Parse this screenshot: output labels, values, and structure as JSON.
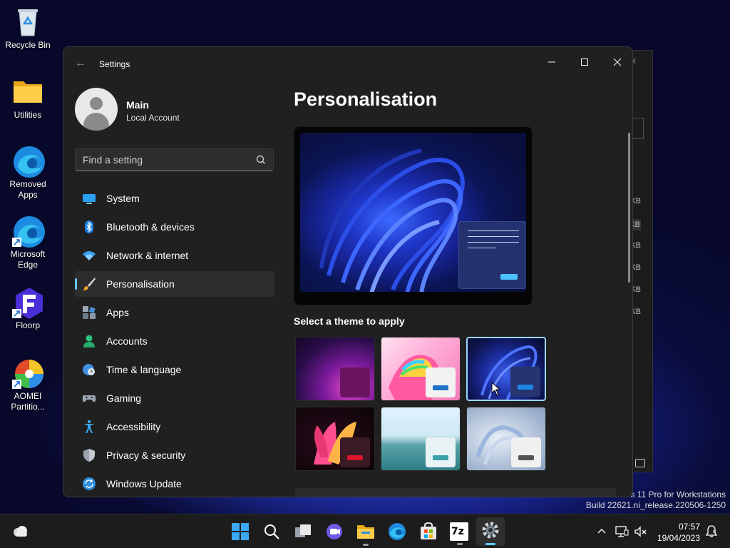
{
  "desktop": {
    "icons": [
      {
        "label": "Recycle Bin"
      },
      {
        "label": "Utilities"
      },
      {
        "label": "Removed Apps"
      },
      {
        "label": "Microsoft Edge"
      },
      {
        "label": "Floorp"
      },
      {
        "label": "AOMEI Partitio..."
      }
    ],
    "watermark": {
      "line1": "s 11 Pro for Workstations",
      "line2": "Build 22621.ni_release.220506-1250"
    },
    "back_window": {
      "size_suffix": "KB"
    }
  },
  "settings": {
    "title": "Settings",
    "user": {
      "name": "Main",
      "account_type": "Local Account"
    },
    "search": {
      "placeholder": "Find a setting",
      "value": ""
    },
    "nav": [
      {
        "label": "System",
        "icon": "monitor-icon"
      },
      {
        "label": "Bluetooth & devices",
        "icon": "bluetooth-icon"
      },
      {
        "label": "Network & internet",
        "icon": "wifi-icon"
      },
      {
        "label": "Personalisation",
        "icon": "paintbrush-icon",
        "active": true
      },
      {
        "label": "Apps",
        "icon": "apps-icon"
      },
      {
        "label": "Accounts",
        "icon": "person-icon"
      },
      {
        "label": "Time & language",
        "icon": "clock-globe-icon"
      },
      {
        "label": "Gaming",
        "icon": "gamepad-icon"
      },
      {
        "label": "Accessibility",
        "icon": "accessibility-icon"
      },
      {
        "label": "Privacy & security",
        "icon": "shield-icon"
      },
      {
        "label": "Windows Update",
        "icon": "update-icon"
      }
    ],
    "page": {
      "title": "Personalisation",
      "theme_heading": "Select a theme to apply",
      "selected_theme_index": 2
    }
  },
  "taskbar": {
    "apps": [
      "start-icon",
      "search-icon",
      "task-view-icon",
      "chat-icon",
      "file-explorer-icon",
      "edge-icon",
      "store-icon",
      "7zip-icon",
      "settings-icon"
    ],
    "sevenzip_label": "7z",
    "time": "07:57",
    "date": "19/04/2023"
  },
  "colors": {
    "accent": "#60cdff"
  }
}
